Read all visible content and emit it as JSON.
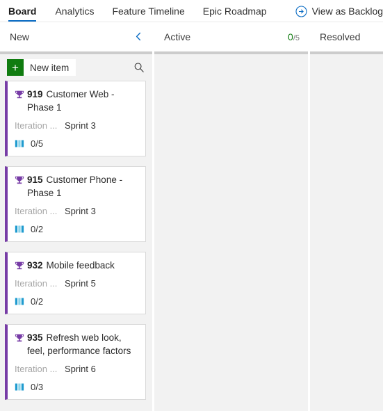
{
  "topnav": {
    "tabs": [
      {
        "label": "Board",
        "active": true
      },
      {
        "label": "Analytics",
        "active": false
      },
      {
        "label": "Feature Timeline",
        "active": false
      },
      {
        "label": "Epic Roadmap",
        "active": false
      }
    ],
    "backlog_link": {
      "label": "View as Backlog",
      "icon": "arrow-right-circle-icon"
    }
  },
  "toolbar": {
    "new_item_label": "New item",
    "new_item_icon": "plus-icon",
    "search_icon": "search-icon"
  },
  "columns": [
    {
      "title": "New",
      "count": "",
      "limit": "",
      "collapse_icon": "chevron-left-icon",
      "has_toolbar": true
    },
    {
      "title": "Active",
      "count": "0",
      "limit": "/5",
      "collapse_icon": "",
      "has_toolbar": false
    },
    {
      "title": "Resolved",
      "count": "",
      "limit": "",
      "collapse_icon": "",
      "has_toolbar": false
    }
  ],
  "cards": [
    {
      "id": "919",
      "title": "Customer Web - Phase 1",
      "type_icon": "trophy-icon",
      "field_label": "Iteration ...",
      "field_value": "Sprint 3",
      "progress_icon": "progress-bars-icon",
      "progress": "0/5"
    },
    {
      "id": "915",
      "title": "Customer Phone - Phase 1",
      "type_icon": "trophy-icon",
      "field_label": "Iteration ...",
      "field_value": "Sprint 3",
      "progress_icon": "progress-bars-icon",
      "progress": "0/2"
    },
    {
      "id": "932",
      "title": "Mobile feedback",
      "type_icon": "trophy-icon",
      "field_label": "Iteration ...",
      "field_value": "Sprint 5",
      "progress_icon": "progress-bars-icon",
      "progress": "0/2"
    },
    {
      "id": "935",
      "title": "Refresh web look, feel, performance factors",
      "type_icon": "trophy-icon",
      "field_label": "Iteration ...",
      "field_value": "Sprint 6",
      "progress_icon": "progress-bars-icon",
      "progress": "0/3"
    }
  ],
  "colors": {
    "accent": "#0a6cc4",
    "epic": "#773ca6",
    "green": "#107c10",
    "progress": "#1f9bcf",
    "column_bg": "#f2f2f2"
  }
}
